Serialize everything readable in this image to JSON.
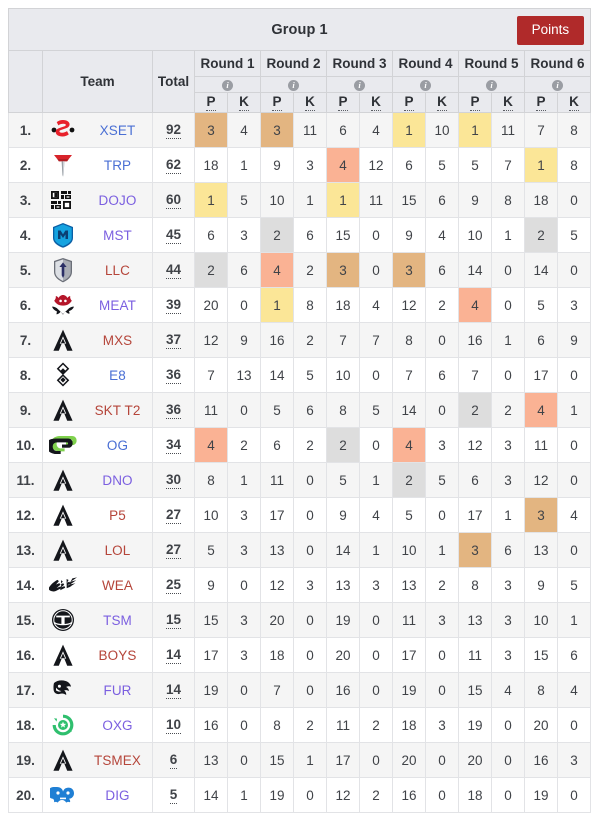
{
  "header": {
    "title": "Group 1",
    "points_button": "Points",
    "columns": {
      "rank": "",
      "team": "Team",
      "total": "Total",
      "p": "P",
      "k": "K",
      "info_icon": "info-icon"
    },
    "rounds": [
      "Round 1",
      "Round 2",
      "Round 3",
      "Round 4",
      "Round 5",
      "Round 6"
    ]
  },
  "colors": {
    "points_button": "#b02a2a",
    "header_bg": "#e9eaee",
    "highlight_tan": "#e3b581",
    "highlight_yellow": "#fbe697",
    "highlight_gray": "#dddddd",
    "highlight_salmon": "#fab294",
    "team_blue": "#4a6fd4",
    "team_violet": "#7b5fe0",
    "team_red": "#b5453a"
  },
  "rows": [
    {
      "rank": "1.",
      "team": "XSET",
      "logo": "xset-logo",
      "color": "#4a6fd4",
      "total": "92",
      "cells": [
        {
          "v": "3",
          "h": "tan"
        },
        {
          "v": "4",
          "h": ""
        },
        {
          "v": "3",
          "h": "tan"
        },
        {
          "v": "11",
          "h": ""
        },
        {
          "v": "6",
          "h": ""
        },
        {
          "v": "4",
          "h": ""
        },
        {
          "v": "1",
          "h": "yellow"
        },
        {
          "v": "10",
          "h": ""
        },
        {
          "v": "1",
          "h": "yellow"
        },
        {
          "v": "11",
          "h": ""
        },
        {
          "v": "7",
          "h": ""
        },
        {
          "v": "8",
          "h": ""
        }
      ]
    },
    {
      "rank": "2.",
      "team": "TRP",
      "logo": "trp-logo",
      "color": "#4a6fd4",
      "total": "62",
      "cells": [
        {
          "v": "18",
          "h": ""
        },
        {
          "v": "1",
          "h": ""
        },
        {
          "v": "9",
          "h": ""
        },
        {
          "v": "3",
          "h": ""
        },
        {
          "v": "4",
          "h": "salmon"
        },
        {
          "v": "12",
          "h": ""
        },
        {
          "v": "6",
          "h": ""
        },
        {
          "v": "5",
          "h": ""
        },
        {
          "v": "5",
          "h": ""
        },
        {
          "v": "7",
          "h": ""
        },
        {
          "v": "1",
          "h": "yellow"
        },
        {
          "v": "8",
          "h": ""
        }
      ]
    },
    {
      "rank": "3.",
      "team": "DOJO",
      "logo": "dojo-logo",
      "color": "#7b5fe0",
      "total": "60",
      "cells": [
        {
          "v": "1",
          "h": "yellow"
        },
        {
          "v": "5",
          "h": ""
        },
        {
          "v": "10",
          "h": ""
        },
        {
          "v": "1",
          "h": ""
        },
        {
          "v": "1",
          "h": "yellow"
        },
        {
          "v": "11",
          "h": ""
        },
        {
          "v": "15",
          "h": ""
        },
        {
          "v": "6",
          "h": ""
        },
        {
          "v": "9",
          "h": ""
        },
        {
          "v": "8",
          "h": ""
        },
        {
          "v": "18",
          "h": ""
        },
        {
          "v": "0",
          "h": ""
        }
      ]
    },
    {
      "rank": "4.",
      "team": "MST",
      "logo": "mst-logo",
      "color": "#7b5fe0",
      "total": "45",
      "cells": [
        {
          "v": "6",
          "h": ""
        },
        {
          "v": "3",
          "h": ""
        },
        {
          "v": "2",
          "h": "gray"
        },
        {
          "v": "6",
          "h": ""
        },
        {
          "v": "15",
          "h": ""
        },
        {
          "v": "0",
          "h": ""
        },
        {
          "v": "9",
          "h": ""
        },
        {
          "v": "4",
          "h": ""
        },
        {
          "v": "10",
          "h": ""
        },
        {
          "v": "1",
          "h": ""
        },
        {
          "v": "2",
          "h": "gray"
        },
        {
          "v": "5",
          "h": ""
        }
      ]
    },
    {
      "rank": "5.",
      "team": "LLC",
      "logo": "llc-logo",
      "color": "#b5453a",
      "total": "44",
      "cells": [
        {
          "v": "2",
          "h": "gray"
        },
        {
          "v": "6",
          "h": ""
        },
        {
          "v": "4",
          "h": "salmon"
        },
        {
          "v": "2",
          "h": ""
        },
        {
          "v": "3",
          "h": "tan"
        },
        {
          "v": "0",
          "h": ""
        },
        {
          "v": "3",
          "h": "tan"
        },
        {
          "v": "6",
          "h": ""
        },
        {
          "v": "14",
          "h": ""
        },
        {
          "v": "0",
          "h": ""
        },
        {
          "v": "14",
          "h": ""
        },
        {
          "v": "0",
          "h": ""
        }
      ]
    },
    {
      "rank": "6.",
      "team": "MEAT",
      "logo": "meat-logo",
      "color": "#7b5fe0",
      "total": "39",
      "cells": [
        {
          "v": "20",
          "h": ""
        },
        {
          "v": "0",
          "h": ""
        },
        {
          "v": "1",
          "h": "yellow"
        },
        {
          "v": "8",
          "h": ""
        },
        {
          "v": "18",
          "h": ""
        },
        {
          "v": "4",
          "h": ""
        },
        {
          "v": "12",
          "h": ""
        },
        {
          "v": "2",
          "h": ""
        },
        {
          "v": "4",
          "h": "salmon"
        },
        {
          "v": "0",
          "h": ""
        },
        {
          "v": "5",
          "h": ""
        },
        {
          "v": "3",
          "h": ""
        }
      ]
    },
    {
      "rank": "7.",
      "team": "MXS",
      "logo": "apex-logo",
      "color": "#b5453a",
      "total": "37",
      "cells": [
        {
          "v": "12",
          "h": ""
        },
        {
          "v": "9",
          "h": ""
        },
        {
          "v": "16",
          "h": ""
        },
        {
          "v": "2",
          "h": ""
        },
        {
          "v": "7",
          "h": ""
        },
        {
          "v": "7",
          "h": ""
        },
        {
          "v": "8",
          "h": ""
        },
        {
          "v": "0",
          "h": ""
        },
        {
          "v": "16",
          "h": ""
        },
        {
          "v": "1",
          "h": ""
        },
        {
          "v": "6",
          "h": ""
        },
        {
          "v": "9",
          "h": ""
        }
      ]
    },
    {
      "rank": "8.",
      "team": "E8",
      "logo": "e8-logo",
      "color": "#4a6fd4",
      "total": "36",
      "cells": [
        {
          "v": "7",
          "h": ""
        },
        {
          "v": "13",
          "h": ""
        },
        {
          "v": "14",
          "h": ""
        },
        {
          "v": "5",
          "h": ""
        },
        {
          "v": "10",
          "h": ""
        },
        {
          "v": "0",
          "h": ""
        },
        {
          "v": "7",
          "h": ""
        },
        {
          "v": "6",
          "h": ""
        },
        {
          "v": "7",
          "h": ""
        },
        {
          "v": "0",
          "h": ""
        },
        {
          "v": "17",
          "h": ""
        },
        {
          "v": "0",
          "h": ""
        }
      ]
    },
    {
      "rank": "9.",
      "team": "SKT T2",
      "logo": "apex-logo",
      "color": "#b5453a",
      "total": "36",
      "cells": [
        {
          "v": "11",
          "h": ""
        },
        {
          "v": "0",
          "h": ""
        },
        {
          "v": "5",
          "h": ""
        },
        {
          "v": "6",
          "h": ""
        },
        {
          "v": "8",
          "h": ""
        },
        {
          "v": "5",
          "h": ""
        },
        {
          "v": "14",
          "h": ""
        },
        {
          "v": "0",
          "h": ""
        },
        {
          "v": "2",
          "h": "gray"
        },
        {
          "v": "2",
          "h": ""
        },
        {
          "v": "4",
          "h": "salmon"
        },
        {
          "v": "1",
          "h": ""
        }
      ]
    },
    {
      "rank": "10.",
      "team": "OG",
      "logo": "og-logo",
      "color": "#4a6fd4",
      "total": "34",
      "cells": [
        {
          "v": "4",
          "h": "salmon"
        },
        {
          "v": "2",
          "h": ""
        },
        {
          "v": "6",
          "h": ""
        },
        {
          "v": "2",
          "h": ""
        },
        {
          "v": "2",
          "h": "gray"
        },
        {
          "v": "0",
          "h": ""
        },
        {
          "v": "4",
          "h": "salmon"
        },
        {
          "v": "3",
          "h": ""
        },
        {
          "v": "12",
          "h": ""
        },
        {
          "v": "3",
          "h": ""
        },
        {
          "v": "11",
          "h": ""
        },
        {
          "v": "0",
          "h": ""
        }
      ]
    },
    {
      "rank": "11.",
      "team": "DNO",
      "logo": "apex-logo",
      "color": "#7b5fe0",
      "total": "30",
      "cells": [
        {
          "v": "8",
          "h": ""
        },
        {
          "v": "1",
          "h": ""
        },
        {
          "v": "11",
          "h": ""
        },
        {
          "v": "0",
          "h": ""
        },
        {
          "v": "5",
          "h": ""
        },
        {
          "v": "1",
          "h": ""
        },
        {
          "v": "2",
          "h": "gray"
        },
        {
          "v": "5",
          "h": ""
        },
        {
          "v": "6",
          "h": ""
        },
        {
          "v": "3",
          "h": ""
        },
        {
          "v": "12",
          "h": ""
        },
        {
          "v": "0",
          "h": ""
        }
      ]
    },
    {
      "rank": "12.",
      "team": "P5",
      "logo": "apex-logo",
      "color": "#b5453a",
      "total": "27",
      "cells": [
        {
          "v": "10",
          "h": ""
        },
        {
          "v": "3",
          "h": ""
        },
        {
          "v": "17",
          "h": ""
        },
        {
          "v": "0",
          "h": ""
        },
        {
          "v": "9",
          "h": ""
        },
        {
          "v": "4",
          "h": ""
        },
        {
          "v": "5",
          "h": ""
        },
        {
          "v": "0",
          "h": ""
        },
        {
          "v": "17",
          "h": ""
        },
        {
          "v": "1",
          "h": ""
        },
        {
          "v": "3",
          "h": "tan"
        },
        {
          "v": "4",
          "h": ""
        }
      ]
    },
    {
      "rank": "13.",
      "team": "LOL",
      "logo": "apex-logo",
      "color": "#b5453a",
      "total": "27",
      "cells": [
        {
          "v": "5",
          "h": ""
        },
        {
          "v": "3",
          "h": ""
        },
        {
          "v": "13",
          "h": ""
        },
        {
          "v": "0",
          "h": ""
        },
        {
          "v": "14",
          "h": ""
        },
        {
          "v": "1",
          "h": ""
        },
        {
          "v": "10",
          "h": ""
        },
        {
          "v": "1",
          "h": ""
        },
        {
          "v": "3",
          "h": "tan"
        },
        {
          "v": "6",
          "h": ""
        },
        {
          "v": "13",
          "h": ""
        },
        {
          "v": "0",
          "h": ""
        }
      ]
    },
    {
      "rank": "14.",
      "team": "WEA",
      "logo": "wea-logo",
      "color": "#b5453a",
      "total": "25",
      "cells": [
        {
          "v": "9",
          "h": ""
        },
        {
          "v": "0",
          "h": ""
        },
        {
          "v": "12",
          "h": ""
        },
        {
          "v": "3",
          "h": ""
        },
        {
          "v": "13",
          "h": ""
        },
        {
          "v": "3",
          "h": ""
        },
        {
          "v": "13",
          "h": ""
        },
        {
          "v": "2",
          "h": ""
        },
        {
          "v": "8",
          "h": ""
        },
        {
          "v": "3",
          "h": ""
        },
        {
          "v": "9",
          "h": ""
        },
        {
          "v": "5",
          "h": ""
        }
      ]
    },
    {
      "rank": "15.",
      "team": "TSM",
      "logo": "tsm-logo",
      "color": "#7b5fe0",
      "total": "15",
      "cells": [
        {
          "v": "15",
          "h": ""
        },
        {
          "v": "3",
          "h": ""
        },
        {
          "v": "20",
          "h": ""
        },
        {
          "v": "0",
          "h": ""
        },
        {
          "v": "19",
          "h": ""
        },
        {
          "v": "0",
          "h": ""
        },
        {
          "v": "11",
          "h": ""
        },
        {
          "v": "3",
          "h": ""
        },
        {
          "v": "13",
          "h": ""
        },
        {
          "v": "3",
          "h": ""
        },
        {
          "v": "10",
          "h": ""
        },
        {
          "v": "1",
          "h": ""
        }
      ]
    },
    {
      "rank": "16.",
      "team": "BOYS",
      "logo": "apex-logo",
      "color": "#b5453a",
      "total": "14",
      "cells": [
        {
          "v": "17",
          "h": ""
        },
        {
          "v": "3",
          "h": ""
        },
        {
          "v": "18",
          "h": ""
        },
        {
          "v": "0",
          "h": ""
        },
        {
          "v": "20",
          "h": ""
        },
        {
          "v": "0",
          "h": ""
        },
        {
          "v": "17",
          "h": ""
        },
        {
          "v": "0",
          "h": ""
        },
        {
          "v": "11",
          "h": ""
        },
        {
          "v": "3",
          "h": ""
        },
        {
          "v": "15",
          "h": ""
        },
        {
          "v": "6",
          "h": ""
        }
      ]
    },
    {
      "rank": "17.",
      "team": "FUR",
      "logo": "fur-logo",
      "color": "#7b5fe0",
      "total": "14",
      "cells": [
        {
          "v": "19",
          "h": ""
        },
        {
          "v": "0",
          "h": ""
        },
        {
          "v": "7",
          "h": ""
        },
        {
          "v": "0",
          "h": ""
        },
        {
          "v": "16",
          "h": ""
        },
        {
          "v": "0",
          "h": ""
        },
        {
          "v": "19",
          "h": ""
        },
        {
          "v": "0",
          "h": ""
        },
        {
          "v": "15",
          "h": ""
        },
        {
          "v": "4",
          "h": ""
        },
        {
          "v": "8",
          "h": ""
        },
        {
          "v": "4",
          "h": ""
        }
      ]
    },
    {
      "rank": "18.",
      "team": "OXG",
      "logo": "oxg-logo",
      "color": "#7b5fe0",
      "total": "10",
      "cells": [
        {
          "v": "16",
          "h": ""
        },
        {
          "v": "0",
          "h": ""
        },
        {
          "v": "8",
          "h": ""
        },
        {
          "v": "2",
          "h": ""
        },
        {
          "v": "11",
          "h": ""
        },
        {
          "v": "2",
          "h": ""
        },
        {
          "v": "18",
          "h": ""
        },
        {
          "v": "3",
          "h": ""
        },
        {
          "v": "19",
          "h": ""
        },
        {
          "v": "0",
          "h": ""
        },
        {
          "v": "20",
          "h": ""
        },
        {
          "v": "0",
          "h": ""
        }
      ]
    },
    {
      "rank": "19.",
      "team": "TSMEX",
      "logo": "apex-logo",
      "color": "#b5453a",
      "total": "6",
      "cells": [
        {
          "v": "13",
          "h": ""
        },
        {
          "v": "0",
          "h": ""
        },
        {
          "v": "15",
          "h": ""
        },
        {
          "v": "1",
          "h": ""
        },
        {
          "v": "17",
          "h": ""
        },
        {
          "v": "0",
          "h": ""
        },
        {
          "v": "20",
          "h": ""
        },
        {
          "v": "0",
          "h": ""
        },
        {
          "v": "20",
          "h": ""
        },
        {
          "v": "0",
          "h": ""
        },
        {
          "v": "16",
          "h": ""
        },
        {
          "v": "3",
          "h": ""
        }
      ]
    },
    {
      "rank": "20.",
      "team": "DIG",
      "logo": "dig-logo",
      "color": "#7b5fe0",
      "total": "5",
      "cells": [
        {
          "v": "14",
          "h": ""
        },
        {
          "v": "1",
          "h": ""
        },
        {
          "v": "19",
          "h": ""
        },
        {
          "v": "0",
          "h": ""
        },
        {
          "v": "12",
          "h": ""
        },
        {
          "v": "2",
          "h": ""
        },
        {
          "v": "16",
          "h": ""
        },
        {
          "v": "0",
          "h": ""
        },
        {
          "v": "18",
          "h": ""
        },
        {
          "v": "0",
          "h": ""
        },
        {
          "v": "19",
          "h": ""
        },
        {
          "v": "0",
          "h": ""
        }
      ]
    }
  ]
}
